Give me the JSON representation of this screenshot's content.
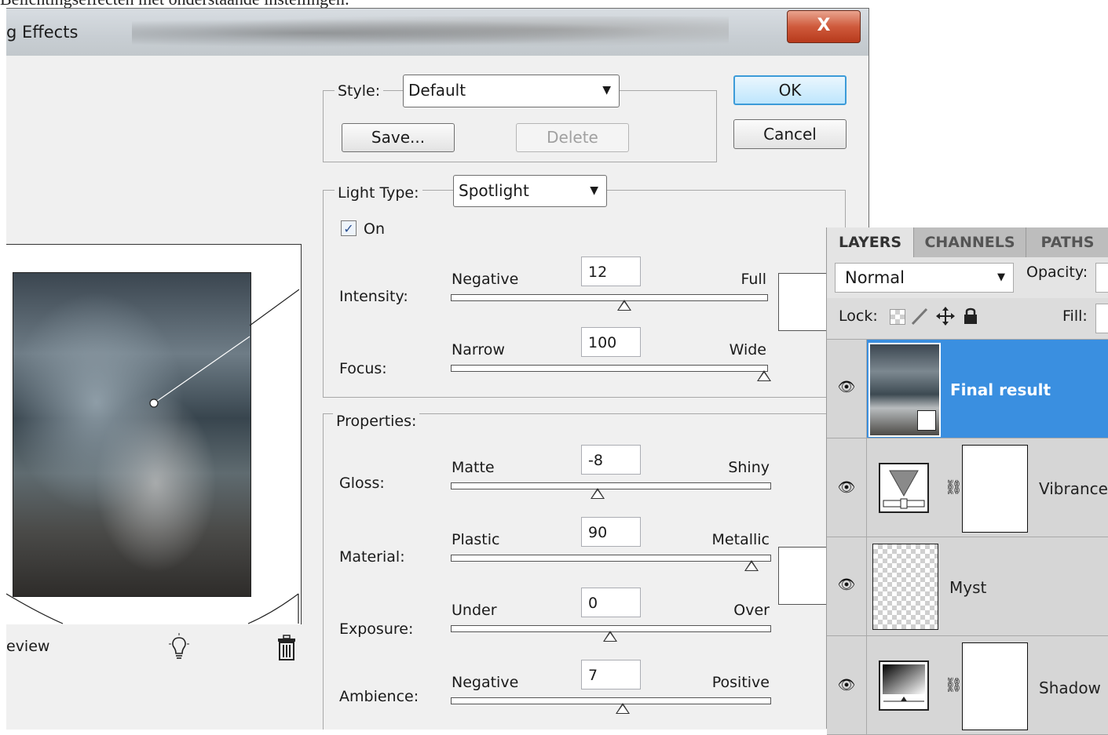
{
  "caption": "Belichtingseffecten met onderstaande instellingen:",
  "dialog": {
    "title": "g Effects",
    "close_glyph": "X",
    "style_label": "Style:",
    "style_value": "Default",
    "save_label": "Save...",
    "delete_label": "Delete",
    "ok_label": "OK",
    "cancel_label": "Cancel",
    "light_type_label": "Light Type:",
    "light_type_value": "Spotlight",
    "on_label": "On",
    "on_checked": true,
    "properties_label": "Properties:",
    "preview_label": "eview",
    "sliders": [
      {
        "label": "Intensity:",
        "left": "Negative",
        "right": "Full",
        "value": "12",
        "level": 0.55
      },
      {
        "label": "Focus:",
        "left": "Narrow",
        "right": "Wide",
        "value": "100",
        "level": 1.0
      },
      {
        "label": "Gloss:",
        "left": "Matte",
        "right": "Shiny",
        "value": "-8",
        "level": 0.46
      },
      {
        "label": "Material:",
        "left": "Plastic",
        "right": "Metallic",
        "value": "90",
        "level": 0.95
      },
      {
        "label": "Exposure:",
        "left": "Under",
        "right": "Over",
        "value": "0",
        "level": 0.5
      },
      {
        "label": "Ambience:",
        "left": "Negative",
        "right": "Positive",
        "value": "7",
        "level": 0.54
      }
    ]
  },
  "layers_panel": {
    "tabs": [
      "LAYERS",
      "CHANNELS",
      "PATHS"
    ],
    "blend_mode": "Normal",
    "opacity_label": "Opacity:",
    "lock_label": "Lock:",
    "fill_label": "Fill:",
    "layers": [
      {
        "name": "Final result",
        "selected": true
      },
      {
        "name": "Vibrance",
        "selected": false
      },
      {
        "name": "Myst",
        "selected": false
      },
      {
        "name": "Shadow",
        "selected": false
      }
    ]
  },
  "icons": {
    "eye": "eye-icon",
    "light_bulb": "light-bulb-icon",
    "trash": "trash-icon",
    "chain": "chain-link-icon",
    "lock_transparency": "lock-transparency-icon",
    "lock_paint": "brush-icon",
    "lock_move": "move-icon",
    "lock_all": "padlock-icon"
  },
  "colors": {
    "selection": "#3a8fe0",
    "default_button_border": "#3c9bd8",
    "close_button": "#cf5a3c"
  }
}
